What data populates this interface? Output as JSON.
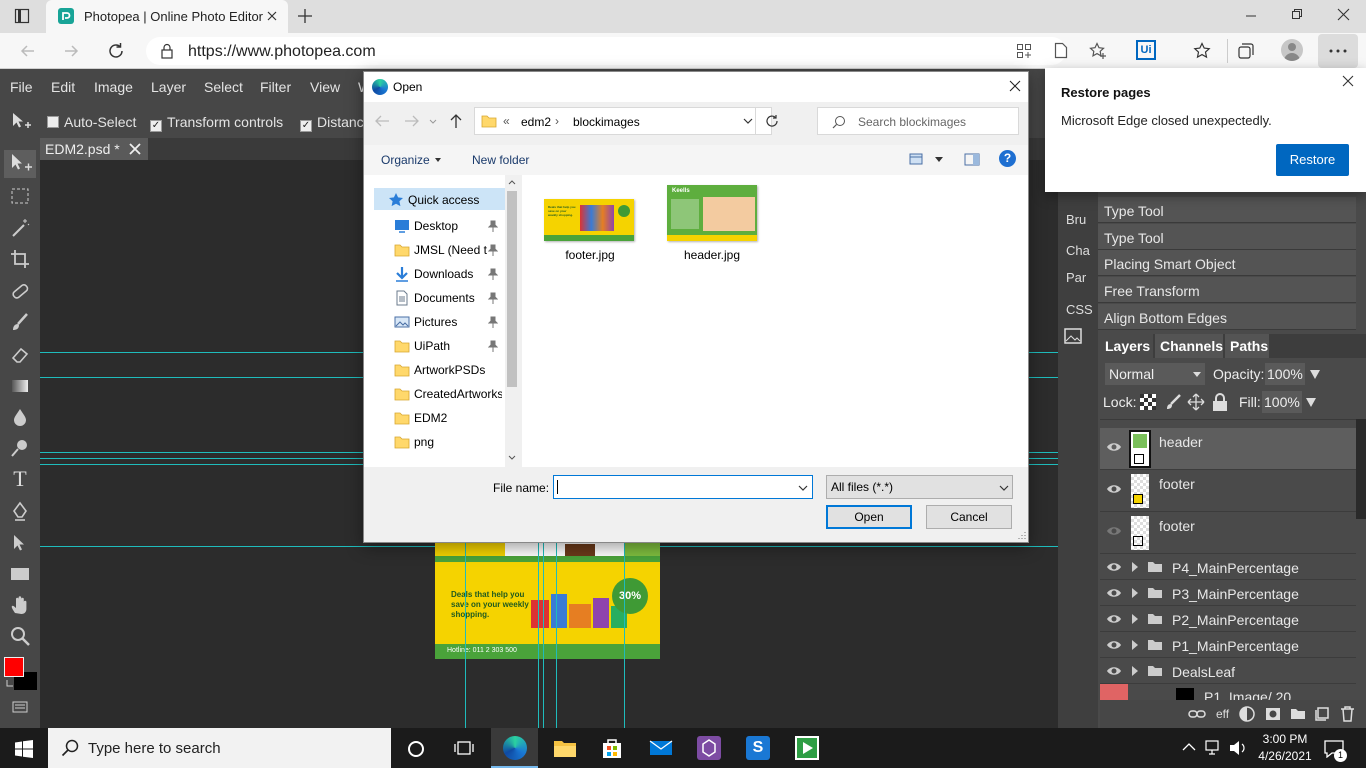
{
  "browser": {
    "tab_title": "Photopea | Online Photo Editor",
    "url": "https://www.photopea.com"
  },
  "app": {
    "menu": [
      "File",
      "Edit",
      "Image",
      "Layer",
      "Select",
      "Filter",
      "View",
      "W"
    ],
    "options": {
      "auto_select": "Auto-Select",
      "transform_controls": "Transform controls",
      "distances": "Distanc"
    },
    "doc_tab": "EDM2.psd *",
    "side_tabs": [
      "Bru",
      "Cha",
      "Par",
      "CSS"
    ],
    "history": [
      "Type Tool",
      "Type Tool",
      "Placing Smart Object",
      "Free Transform",
      "Align Bottom Edges"
    ],
    "layer_tabs": [
      "Layers",
      "Channels",
      "Paths"
    ],
    "blend_mode": "Normal",
    "opacity_label": "Opacity:",
    "opacity": "100%",
    "lock_label": "Lock:",
    "fill_label": "Fill:",
    "fill": "100%",
    "layers": [
      {
        "name": "header",
        "visible": true,
        "selected": true
      },
      {
        "name": "footer",
        "visible": true,
        "selected": false
      },
      {
        "name": "footer",
        "visible": false,
        "selected": false
      }
    ],
    "groups": [
      "P4_MainPercentage",
      "P3_MainPercentage",
      "P2_MainPercentage",
      "P1_MainPercentage",
      "DealsLeaf"
    ],
    "partial_layer": "P1_Image/ 20",
    "footer_bar": "eff",
    "canvas_art": {
      "headline": "Deals that help you save on your weekly shopping.",
      "hotline": "Hotline: 011 2 303 500",
      "badge": "30%"
    }
  },
  "dialog": {
    "title": "Open",
    "path": [
      "edm2",
      "blockimages"
    ],
    "path_prefix": "«",
    "search_placeholder": "Search blockimages",
    "organize": "Organize",
    "new_folder": "New folder",
    "nav": [
      {
        "label": "Quick access",
        "icon": "star-icon"
      },
      {
        "label": "Desktop",
        "icon": "desktop-icon"
      },
      {
        "label": "JMSL (Need t",
        "icon": "folder-icon"
      },
      {
        "label": "Downloads",
        "icon": "download-icon"
      },
      {
        "label": "Documents",
        "icon": "documents-icon"
      },
      {
        "label": "Pictures",
        "icon": "pictures-icon"
      },
      {
        "label": "UiPath",
        "icon": "folder-icon"
      },
      {
        "label": "ArtworkPSDs",
        "icon": "folder-icon"
      },
      {
        "label": "CreatedArtworks",
        "icon": "folder-icon"
      },
      {
        "label": "EDM2",
        "icon": "folder-icon"
      },
      {
        "label": "png",
        "icon": "folder-icon"
      }
    ],
    "files": [
      {
        "name": "footer.jpg",
        "brand": "Deals that help you save on your weekly shopping."
      },
      {
        "name": "header.jpg",
        "brand": "Keells"
      }
    ],
    "file_name_label": "File name:",
    "file_name_value": "",
    "file_type": "All files (*.*)",
    "open_button": "Open",
    "cancel_button": "Cancel"
  },
  "notification": {
    "title": "Restore pages",
    "message": "Microsoft Edge closed unexpectedly.",
    "button": "Restore"
  },
  "taskbar": {
    "search_placeholder": "Type here to search",
    "time": "3:00 PM",
    "date": "4/26/2021",
    "notification_count": "1"
  },
  "colors": {
    "accent": "#0067c0",
    "guide": "#1fbcbc",
    "fg_color": "#ff0000",
    "bg_color": "#000000"
  }
}
